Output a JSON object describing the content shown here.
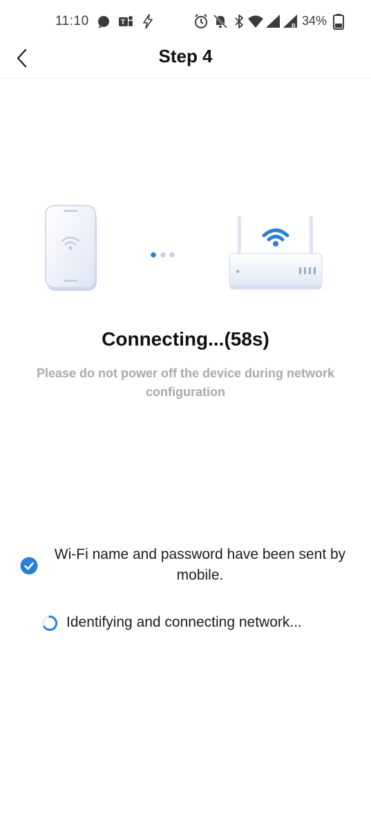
{
  "status_bar": {
    "time": "11:10",
    "battery": "34%",
    "icons": [
      "signal-messenger-icon",
      "teams-icon",
      "bolt-icon",
      "alarm-icon",
      "mute-icon",
      "bluetooth-icon",
      "wifi-icon",
      "cell-signal-icon",
      "cell-signal-roaming-icon",
      "battery-icon"
    ]
  },
  "header": {
    "title": "Step 4",
    "back_icon": "chevron-left-icon"
  },
  "illustration": {
    "left": "phone-icon",
    "middle": "progress-dots-icon",
    "right": "router-icon",
    "accent_color": "#2a7fd8"
  },
  "connection": {
    "title": "Connecting...(58s)",
    "warning": "Please do not power off the device during network configuration"
  },
  "steps": [
    {
      "text": "Wi-Fi name and password have been sent by mobile.",
      "state": "done",
      "icon": "check-circle-icon"
    },
    {
      "text": "Identifying and connecting network...",
      "state": "in-progress",
      "icon": "spinner-icon"
    }
  ],
  "colors": {
    "accent": "#2a7fd8",
    "muted_text": "#a9a9a9",
    "title_text": "#111111"
  }
}
